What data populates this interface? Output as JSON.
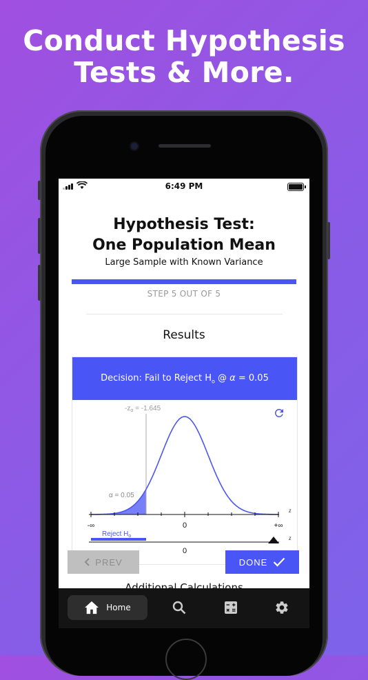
{
  "headline": {
    "line1": "Conduct Hypothesis",
    "line2": "Tests & More."
  },
  "status_bar": {
    "time": "6:49 PM"
  },
  "test": {
    "title_line1": "Hypothesis Test:",
    "title_line2": "One Population Mean",
    "subtitle": "Large Sample with Known Variance",
    "step_label": "STEP 5 OUT OF 5",
    "progress_fraction": 1.0,
    "section_title": "Results",
    "decision_prefix": "Decision: Fail to Reject H",
    "decision_sub": "o",
    "decision_suffix": " @ ",
    "decision_alpha_symbol": "α",
    "decision_alpha_value": " = 0.05",
    "additional_label": "Additional Calculations"
  },
  "chart": {
    "critical_label_prefix": "-z",
    "critical_label_sub": "α",
    "critical_label_value": " = -1.645",
    "alpha_label": "α = 0.05",
    "axis_var": "z",
    "tick_left": "-∞",
    "tick_center": "0",
    "tick_right": "+∞",
    "reject_label_prefix": "Reject H",
    "reject_label_sub": "o",
    "bottom_axis_var": "z",
    "bottom_tick_center": "0",
    "accent_color": "#4a55f5"
  },
  "chart_data": {
    "type": "area",
    "title": "",
    "x_range": [
      -4,
      4
    ],
    "critical_value": -1.645,
    "alpha": 0.05,
    "tail": "left",
    "distribution": "standard normal"
  },
  "nav": {
    "prev_label": "PREV",
    "done_label": "DONE"
  },
  "tabbar": {
    "home_label": "Home",
    "icons": [
      "home-icon",
      "search-icon",
      "calculator-icon",
      "gear-icon"
    ]
  },
  "colors": {
    "accent": "#4a55f5",
    "background_start": "#a04fe0",
    "background_end": "#7d63ea"
  }
}
